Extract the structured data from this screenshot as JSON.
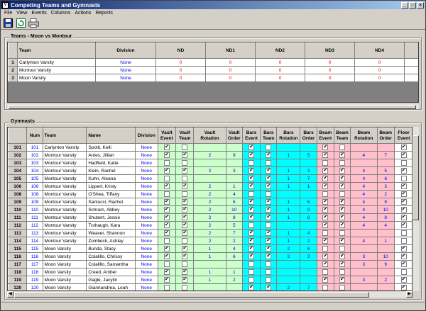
{
  "window": {
    "title": "Competing Teams and Gymnasts",
    "controls": {
      "minimize": "_",
      "maximize": "□",
      "close": "×"
    }
  },
  "menu": [
    "File",
    "View",
    "Events",
    "Columns",
    "Actions",
    "Reports"
  ],
  "toolbar": {
    "icons": [
      "save-icon",
      "refresh-icon",
      "print-icon"
    ]
  },
  "teams_panel": {
    "title": "Teams - Moon vs Montour",
    "headers": [
      "",
      "Team",
      "Division",
      "ND",
      "ND1",
      "ND2",
      "ND3",
      "ND4"
    ],
    "rows": [
      {
        "n": "1",
        "team": "Carlynton Varsity",
        "division": "None",
        "nd": [
          "0",
          "0",
          "0",
          "0",
          "0"
        ]
      },
      {
        "n": "2",
        "team": "Montour Varsity",
        "division": "None",
        "nd": [
          "0",
          "0",
          "0",
          "0",
          "0"
        ]
      },
      {
        "n": "3",
        "team": "Moon Varsity",
        "division": "None",
        "nd": [
          "0",
          "0",
          "0",
          "0",
          "0"
        ]
      }
    ]
  },
  "gymnasts_panel": {
    "title": "Gymnasts",
    "headers": [
      [
        "",
        ""
      ],
      [
        "Num",
        ""
      ],
      [
        "Team",
        ""
      ],
      [
        "Name",
        ""
      ],
      [
        "Division",
        ""
      ],
      [
        "Vault",
        "Event"
      ],
      [
        "Vault",
        "Team"
      ],
      [
        "Vault",
        "Rotation"
      ],
      [
        "Vault",
        "Order"
      ],
      [
        "Bars",
        "Event"
      ],
      [
        "Bars",
        "Team"
      ],
      [
        "Bars",
        "Rotation"
      ],
      [
        "Bars",
        "Order"
      ],
      [
        "Beam",
        "Event"
      ],
      [
        "Beam",
        "Team"
      ],
      [
        "Beam",
        "Rotation"
      ],
      [
        "Beam",
        "Order"
      ],
      [
        "Floor",
        "Event"
      ],
      [
        "Floor",
        "Team"
      ],
      [
        "Floor",
        "Rotation"
      ]
    ],
    "rows": [
      {
        "rh": "101",
        "num": "101",
        "team": "Carlynton Varsity",
        "name": "Spotti, Kelli",
        "div": "None",
        "ve": true,
        "vt": false,
        "vr": "",
        "vo": "",
        "be": true,
        "bt": false,
        "br": "",
        "bo": "",
        "me": true,
        "mt": false,
        "mr": "",
        "mo": "",
        "fe": true,
        "ft": false,
        "fr": "3"
      },
      {
        "rh": "102",
        "num": "102",
        "team": "Montour Varsity",
        "name": "Antes, Jillian",
        "div": "None",
        "ve": true,
        "vt": true,
        "vr": "2",
        "vo": "9",
        "be": true,
        "bt": true,
        "br": "1",
        "bo": "5",
        "me": true,
        "mt": true,
        "mr": "4",
        "mo": "7",
        "fe": true,
        "ft": true,
        "fr": "3"
      },
      {
        "rh": "103",
        "num": "103",
        "team": "Montour Varsity",
        "name": "Hadfield, Katie",
        "div": "None",
        "ve": false,
        "vt": false,
        "vr": "",
        "vo": "",
        "be": false,
        "bt": false,
        "br": "",
        "bo": "",
        "me": false,
        "mt": false,
        "mr": "",
        "mo": "",
        "fe": false,
        "ft": false,
        "fr": ""
      },
      {
        "rh": "104",
        "num": "104",
        "team": "Montour Varsity",
        "name": "Klein, Rachel",
        "div": "None",
        "ve": true,
        "vt": true,
        "vr": "2",
        "vo": "3",
        "be": true,
        "bt": true,
        "br": "1",
        "bo": "3",
        "me": true,
        "mt": true,
        "mr": "4",
        "mo": "5",
        "fe": true,
        "ft": true,
        "fr": "3"
      },
      {
        "rh": "105",
        "num": "105",
        "team": "Montour Varsity",
        "name": "Kuhn, Aleana",
        "div": "None",
        "ve": false,
        "vt": false,
        "vr": "",
        "vo": "",
        "be": true,
        "bt": true,
        "br": "1",
        "bo": "7",
        "me": true,
        "mt": true,
        "mr": "4",
        "mo": "6",
        "fe": false,
        "ft": false,
        "fr": ""
      },
      {
        "rh": "106",
        "num": "106",
        "team": "Montour Varsity",
        "name": "Lippert, Kristy",
        "div": "None",
        "ve": true,
        "vt": true,
        "vr": "2",
        "vo": "1",
        "be": true,
        "bt": true,
        "br": "1",
        "bo": "1",
        "me": true,
        "mt": true,
        "mr": "4",
        "mo": "3",
        "fe": true,
        "ft": true,
        "fr": "3"
      },
      {
        "rh": "108",
        "num": "108",
        "team": "Montour Varsity",
        "name": "O'Shea, Tiffany",
        "div": "None",
        "ve": false,
        "vt": false,
        "vr": "2",
        "vo": "4",
        "be": false,
        "bt": false,
        "br": "",
        "bo": "",
        "me": false,
        "mt": false,
        "mr": "4",
        "mo": "2",
        "fe": true,
        "ft": true,
        "fr": "3"
      },
      {
        "rh": "109",
        "num": "109",
        "team": "Montour Varsity",
        "name": "Santucci, Rachel",
        "div": "None",
        "ve": true,
        "vt": true,
        "vr": "2",
        "vo": "6",
        "be": true,
        "bt": true,
        "br": "1",
        "bo": "6",
        "me": true,
        "mt": true,
        "mr": "4",
        "mo": "9",
        "fe": true,
        "ft": true,
        "fr": "3"
      },
      {
        "rh": "110",
        "num": "110",
        "team": "Montour Varsity",
        "name": "Schram, Abbey",
        "div": "None",
        "ve": true,
        "vt": true,
        "vr": "2",
        "vo": "10",
        "be": true,
        "bt": true,
        "br": "1",
        "bo": "9",
        "me": true,
        "mt": true,
        "mr": "4",
        "mo": "10",
        "fe": true,
        "ft": true,
        "fr": "3"
      },
      {
        "rh": "111",
        "num": "111",
        "team": "Montour Varsity",
        "name": "Shubert, Jessie",
        "div": "None",
        "ve": true,
        "vt": true,
        "vr": "2",
        "vo": "8",
        "be": true,
        "bt": true,
        "br": "1",
        "bo": "8",
        "me": true,
        "mt": true,
        "mr": "4",
        "mo": "8",
        "fe": true,
        "ft": true,
        "fr": "3"
      },
      {
        "rh": "112",
        "num": "112",
        "team": "Montour Varsity",
        "name": "Trohaugh, Kara",
        "div": "None",
        "ve": true,
        "vt": true,
        "vr": "2",
        "vo": "5",
        "be": false,
        "bt": false,
        "br": "",
        "bo": "",
        "me": true,
        "mt": true,
        "mr": "4",
        "mo": "4",
        "fe": true,
        "ft": true,
        "fr": "3"
      },
      {
        "rh": "113",
        "num": "113",
        "team": "Montour Varsity",
        "name": "Weaver, Shannon",
        "div": "None",
        "ve": true,
        "vt": true,
        "vr": "2",
        "vo": "7",
        "be": true,
        "bt": true,
        "br": "1",
        "bo": "4",
        "me": false,
        "mt": false,
        "mr": "",
        "mo": "",
        "fe": false,
        "ft": false,
        "fr": ""
      },
      {
        "rh": "114",
        "num": "114",
        "team": "Montour Varsity",
        "name": "Zombeck, Ashley",
        "div": "None",
        "ve": false,
        "vt": false,
        "vr": "2",
        "vo": "2",
        "be": true,
        "bt": true,
        "br": "1",
        "bo": "2",
        "me": true,
        "mt": true,
        "mr": "4",
        "mo": "1",
        "fe": false,
        "ft": false,
        "fr": ""
      },
      {
        "rh": "115",
        "num": "115",
        "team": "Moon Varsity",
        "name": "Bunda, Stacy",
        "div": "None",
        "ve": true,
        "vt": true,
        "vr": "1",
        "vo": "4",
        "be": true,
        "bt": true,
        "br": "2",
        "bo": "6",
        "me": false,
        "mt": false,
        "mr": "",
        "mo": "",
        "fe": true,
        "ft": true,
        "fr": "4"
      },
      {
        "rh": "116",
        "num": "116",
        "team": "Moon Varsity",
        "name": "Colalillo, Chrissy",
        "div": "None",
        "ve": true,
        "vt": true,
        "vr": "1",
        "vo": "6",
        "be": true,
        "bt": true,
        "br": "2",
        "bo": "3",
        "me": true,
        "mt": true,
        "mr": "3",
        "mo": "10",
        "fe": true,
        "ft": true,
        "fr": "4"
      },
      {
        "rh": "117",
        "num": "117",
        "team": "Moon Varsity",
        "name": "Colalillo, Samantha",
        "div": "None",
        "ve": false,
        "vt": false,
        "vr": "",
        "vo": "",
        "be": false,
        "bt": false,
        "br": "",
        "bo": "",
        "me": true,
        "mt": true,
        "mr": "3",
        "mo": "9",
        "fe": true,
        "ft": true,
        "fr": "4"
      },
      {
        "rh": "118",
        "num": "118",
        "team": "Moon Varsity",
        "name": "Creed, Amber",
        "div": "None",
        "ve": true,
        "vt": true,
        "vr": "1",
        "vo": "1",
        "be": false,
        "bt": false,
        "br": "",
        "bo": "",
        "me": false,
        "mt": false,
        "mr": "",
        "mo": "",
        "fe": false,
        "ft": false,
        "fr": ""
      },
      {
        "rh": "119",
        "num": "119",
        "team": "Moon Varsity",
        "name": "Gagle, Jacylin",
        "div": "None",
        "ve": true,
        "vt": true,
        "vr": "1",
        "vo": "2",
        "be": false,
        "bt": false,
        "br": "",
        "bo": "",
        "me": true,
        "mt": true,
        "mr": "3",
        "mo": "2",
        "fe": true,
        "ft": true,
        "fr": "4"
      },
      {
        "rh": "120",
        "num": "120",
        "team": "Moon Varsity",
        "name": "Giannandrea, Leah",
        "div": "None",
        "ve": false,
        "vt": false,
        "vr": "",
        "vo": "",
        "be": true,
        "bt": true,
        "br": "2",
        "bo": "7",
        "me": false,
        "mt": false,
        "mr": "",
        "mo": "",
        "fe": true,
        "ft": true,
        "fr": "4"
      }
    ]
  }
}
